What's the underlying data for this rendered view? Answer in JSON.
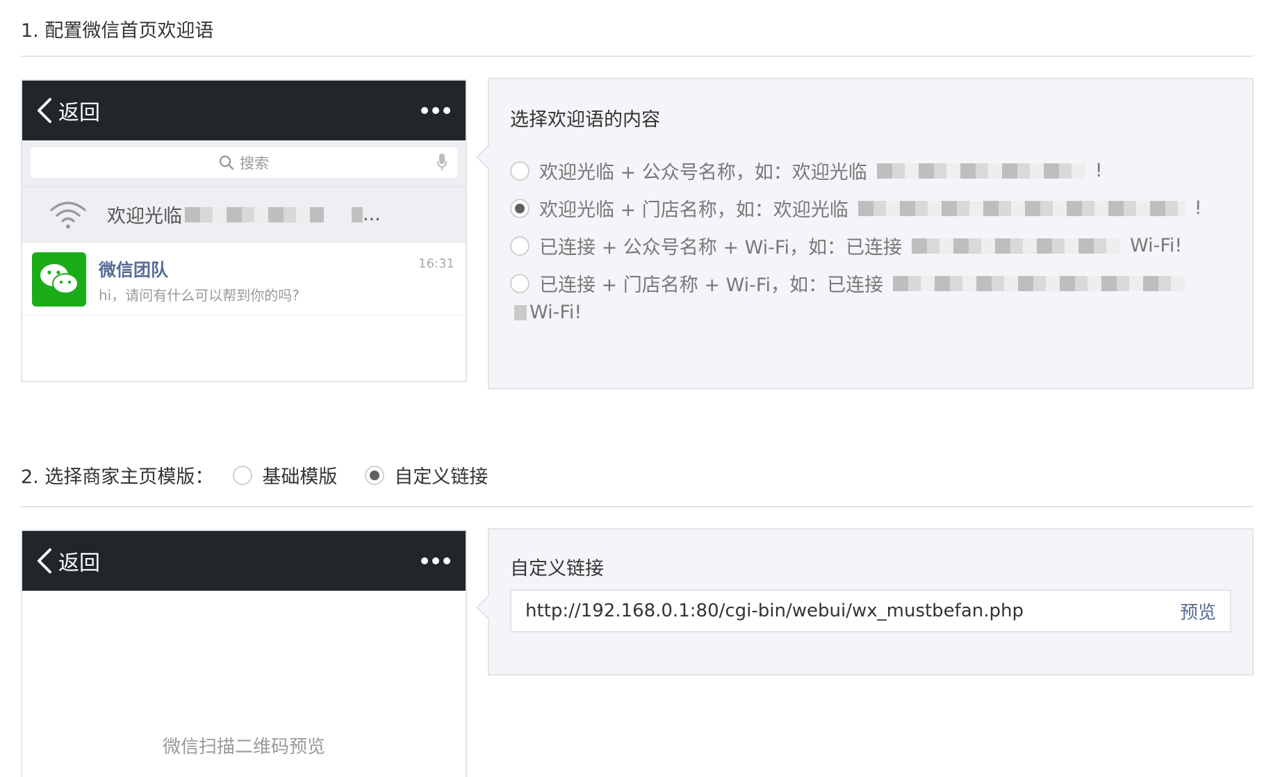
{
  "section1": {
    "title": "1. 配置微信首页欢迎语"
  },
  "phone1": {
    "back_label": "返回",
    "search_placeholder": "搜索",
    "wifi_text": "欢迎光临",
    "wifi_suffix": "...",
    "chat": {
      "name": "微信团队",
      "message": "hi，请问有什么可以帮到你的吗?",
      "time": "16:31"
    }
  },
  "welcome_panel": {
    "title": "选择欢迎语的内容",
    "options": [
      {
        "label": "欢迎光临 + 公众号名称，如：欢迎光临",
        "suffix": "!",
        "selected": false
      },
      {
        "label": "欢迎光临 + 门店名称，如：欢迎光临",
        "suffix": "!",
        "selected": true
      },
      {
        "label": "已连接 + 公众号名称 + Wi-Fi，如：已连接",
        "suffix": "Wi-Fi!",
        "selected": false
      },
      {
        "label": "已连接 + 门店名称 + Wi-Fi，如：已连接",
        "suffix": "Wi-Fi!",
        "selected": false
      }
    ]
  },
  "section2": {
    "title": "2. 选择商家主页模版：",
    "options": [
      {
        "label": "基础模版",
        "selected": false
      },
      {
        "label": "自定义链接",
        "selected": true
      }
    ]
  },
  "phone2": {
    "back_label": "返回",
    "placeholder_text": "微信扫描二维码预览"
  },
  "link_panel": {
    "title": "自定义链接",
    "url": "http://192.168.0.1:80/cgi-bin/webui/wx_mustbefan.php",
    "preview_label": "预览"
  },
  "colors": {
    "phone_bar": "#20262a",
    "panel_bg": "#f4f5f9",
    "link": "#576b95",
    "wechat_green": "#1aad19"
  }
}
